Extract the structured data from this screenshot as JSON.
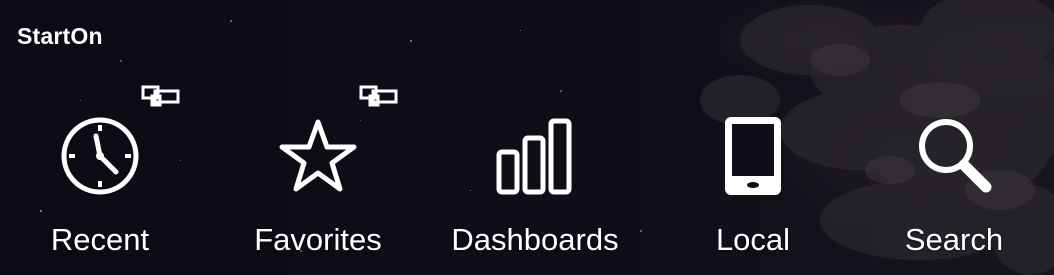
{
  "app": {
    "title": "StartOn"
  },
  "nav": {
    "items": [
      {
        "label": "Recent",
        "icon": "clock-icon",
        "has_badge": true
      },
      {
        "label": "Favorites",
        "icon": "star-icon",
        "has_badge": true
      },
      {
        "label": "Dashboards",
        "icon": "bar-chart-icon",
        "has_badge": false
      },
      {
        "label": "Local",
        "icon": "tablet-icon",
        "has_badge": false
      },
      {
        "label": "Search",
        "icon": "search-icon",
        "has_badge": false
      }
    ]
  },
  "colors": {
    "background": "#100c18",
    "foreground": "#ffffff"
  }
}
